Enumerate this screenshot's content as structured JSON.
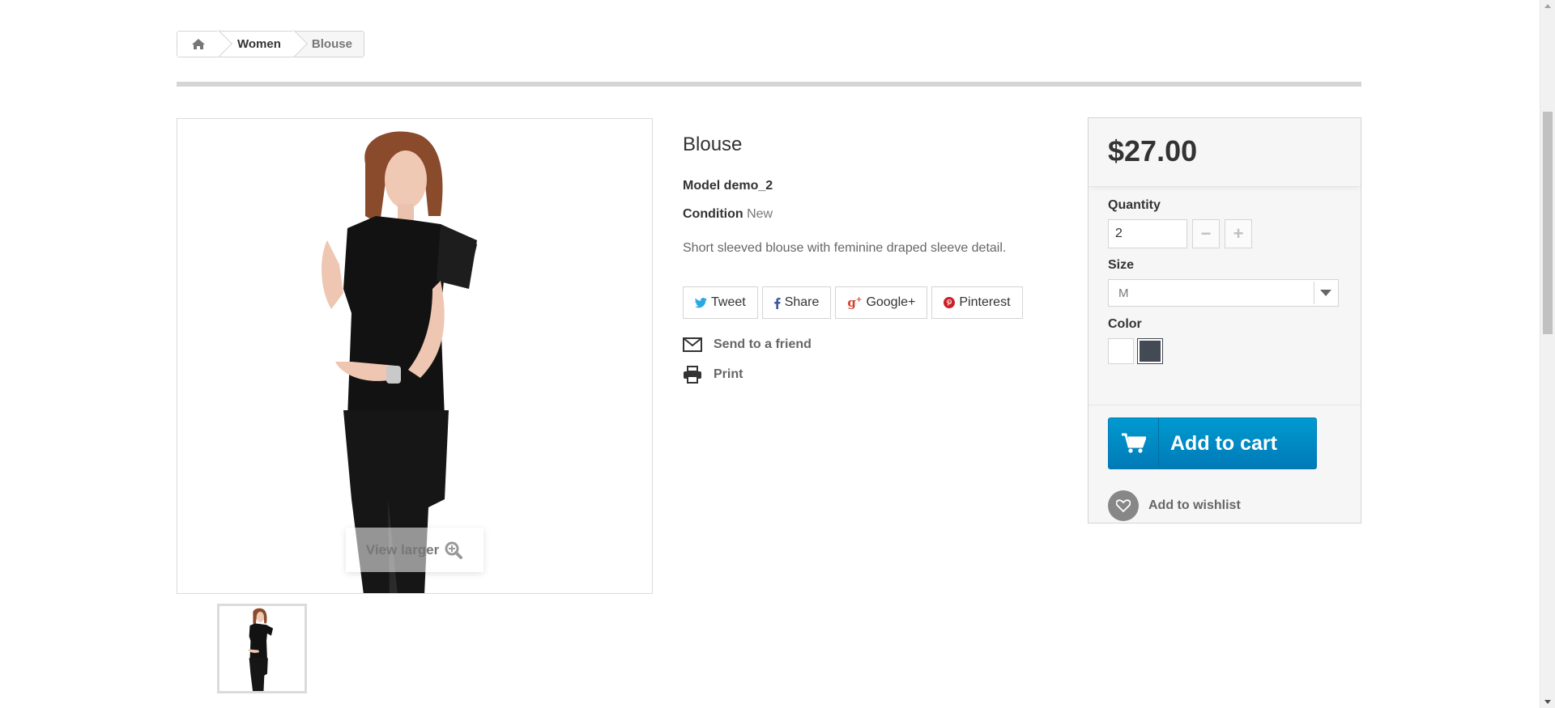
{
  "breadcrumb": {
    "home_icon": "home-icon",
    "items": [
      "Women",
      "Blouse"
    ]
  },
  "product": {
    "title": "Blouse",
    "model_label": "Model",
    "model_value": "demo_2",
    "condition_label": "Condition",
    "condition_value": "New",
    "description": "Short sleeved blouse with feminine draped sleeve detail.",
    "view_larger": "View larger"
  },
  "social": {
    "tweet": "Tweet",
    "share": "Share",
    "google": "Google+",
    "pinterest": "Pinterest"
  },
  "links": {
    "send_friend": "Send to a friend",
    "print": "Print"
  },
  "buybox": {
    "price": "$27.00",
    "quantity_label": "Quantity",
    "quantity_value": "2",
    "size_label": "Size",
    "size_value": "M",
    "color_label": "Color",
    "colors": [
      "#ffffff",
      "#434a54"
    ],
    "selected_color": "#434a54",
    "add_to_cart": "Add to cart",
    "add_to_wishlist": "Add to wishlist"
  },
  "colors": {
    "cart_blue": "#0088c6",
    "twitter": "#2ba8e2",
    "facebook": "#3b5998",
    "google": "#d7422f",
    "pinterest": "#cb2027"
  }
}
